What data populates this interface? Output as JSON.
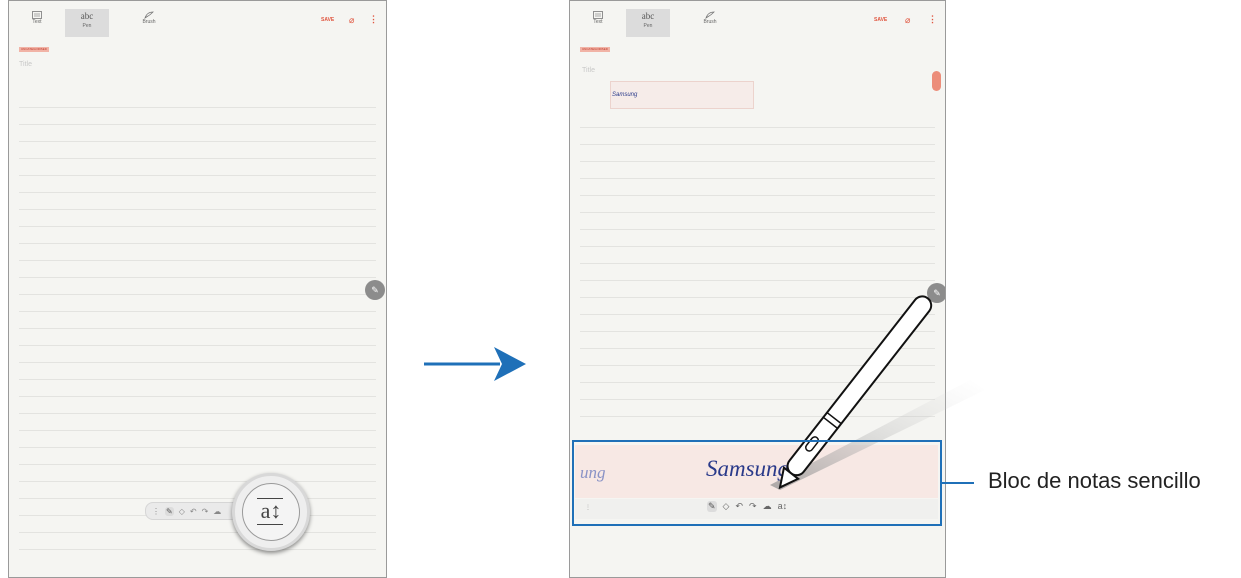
{
  "left_screen": {
    "toolbar": {
      "modes": [
        {
          "label": "Text",
          "icon": "keyboard-icon"
        },
        {
          "label": "Pen",
          "glyph": "abc"
        },
        {
          "label": "Brush",
          "icon": "brush-icon"
        }
      ],
      "save_label": "SAVE",
      "attach_icon": "paperclip-icon",
      "more_icon": "more-vert-icon"
    },
    "category": "UNCATEGORISED",
    "title_placeholder": "Title",
    "pen_tools": [
      "⋮",
      "✎",
      "◇",
      "↶",
      "↷",
      "☁"
    ],
    "zoom_icon_glyph": "a↕"
  },
  "right_screen": {
    "toolbar": {
      "modes": [
        {
          "label": "Text",
          "icon": "keyboard-icon"
        },
        {
          "label": "Pen",
          "glyph": "abc"
        },
        {
          "label": "Brush",
          "icon": "brush-icon"
        }
      ],
      "save_label": "SAVE",
      "attach_icon": "paperclip-icon",
      "more_icon": "more-vert-icon"
    },
    "category": "UNCATEGORISED",
    "title_placeholder": "Title",
    "converted_text": "Samsung",
    "pad_left_text": "ung",
    "pad_main_text": "Samsung",
    "pad_tools": [
      "✎",
      "◇",
      "↶",
      "↷",
      "☁",
      "a↕"
    ],
    "pad_handle": "⋮"
  },
  "callout": {
    "label": "Bloc de notas sencillo",
    "color": "#1f70b8"
  },
  "colors": {
    "accent": "#e0553f",
    "ink": "#2a3a8a",
    "arrow": "#1f70b8"
  }
}
